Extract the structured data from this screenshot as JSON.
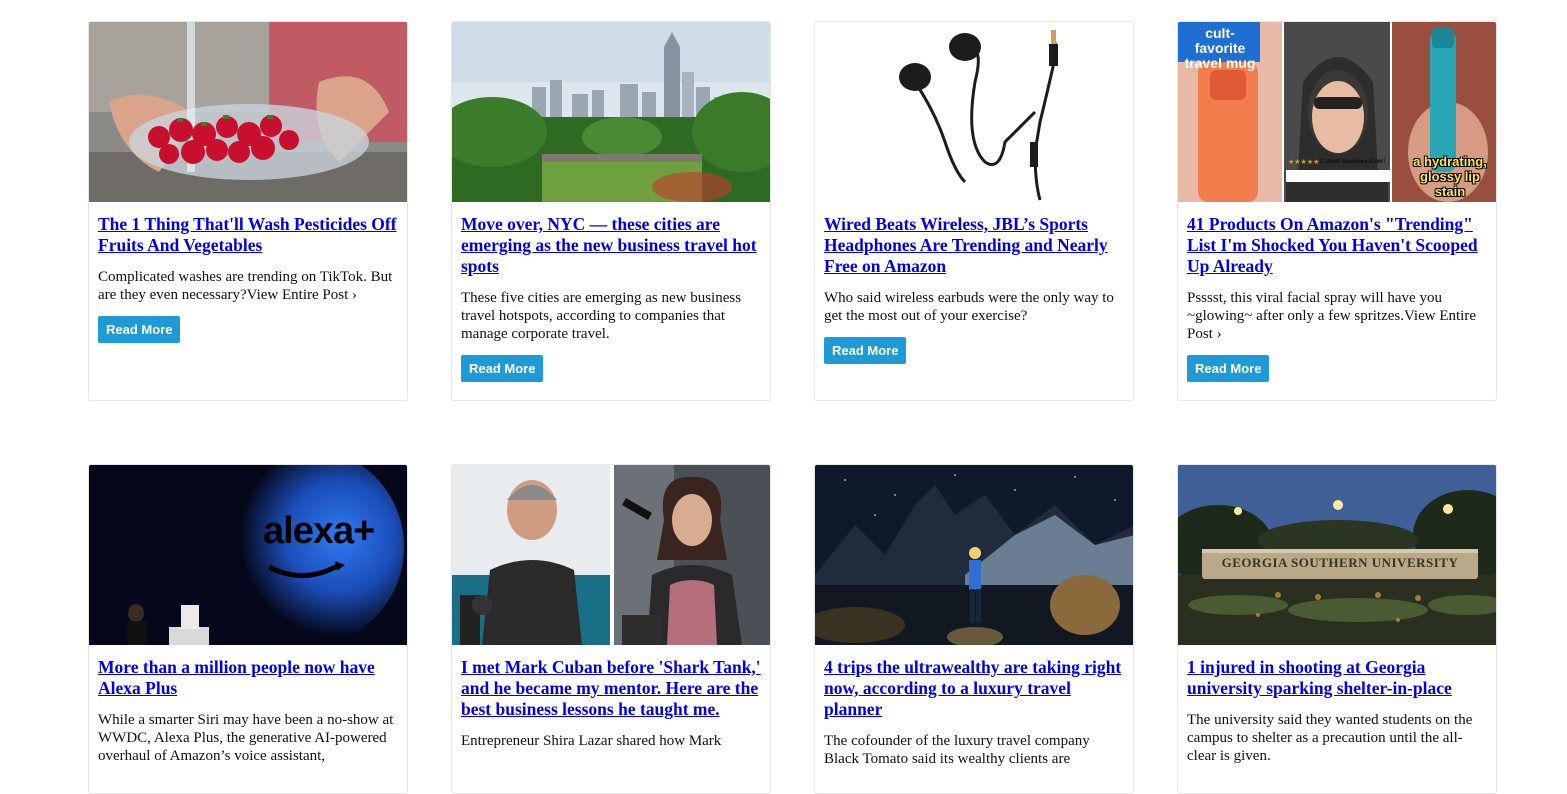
{
  "cards": [
    {
      "title": "The 1 Thing That'll Wash Pesticides Off Fruits And Vegetables",
      "desc": "Complicated washes are trending on TikTok. But are they even necessary?View Entire Post ›",
      "button": "Read More",
      "image": "strawberries-being-washed"
    },
    {
      "title": "Move over, NYC — these cities are emerging as the new business travel hot spots",
      "desc": "These five cities are emerging as new business travel hotspots, according to companies that manage corporate travel.",
      "button": "Read More",
      "image": "city-skyline"
    },
    {
      "title": "Wired Beats Wireless, JBL’s Sports Headphones Are Trending and Nearly Free on Amazon",
      "desc": "Who said wireless earbuds were the only way to get the most out of your exercise?",
      "button": "Read More",
      "image": "wired-earbuds"
    },
    {
      "title": "41 Products On Amazon's \"Trending\" List I'm Shocked You Haven't Scooped Up Already",
      "desc": "Psssst, this viral facial spray will have you ~glowing~ after only a few spritzes.View Entire Post ›",
      "button": "Read More",
      "image": "product-collage",
      "overlay": {
        "mug_caption": "cult-favorite travel mug",
        "stars": "★★★★★",
        "sunnies_caption": "Cutest Sunnies Ever!",
        "lip_caption": "a hydrating, glossy lip stain"
      }
    },
    {
      "title": "More than a million people now have Alexa Plus",
      "desc": "While a smarter Siri may have been a no-show at WWDC, Alexa Plus, the generative AI-powered overhaul of Amazon’s voice assistant,",
      "image": "alexa-plus-stage",
      "overlay": {
        "logo": "alexa+"
      }
    },
    {
      "title": "I met Mark Cuban before 'Shark Tank,' and he became my mentor. Here are the best business lessons he taught me.",
      "desc": "Entrepreneur Shira Lazar shared how Mark",
      "image": "podcast-split"
    },
    {
      "title": "4 trips the ultrawealthy are taking right now, according to a luxury travel planner",
      "desc": "The cofounder of the luxury travel company Black Tomato said its wealthy clients are",
      "image": "night-mountains"
    },
    {
      "title": "1 injured in shooting at Georgia university sparking shelter-in-place",
      "desc": "The university said they wanted students on the campus to shelter as a precaution until the all-clear is given.",
      "image": "university-sign",
      "overlay": {
        "sign": "GEORGIA SOUTHERN UNIVERSITY"
      }
    }
  ]
}
